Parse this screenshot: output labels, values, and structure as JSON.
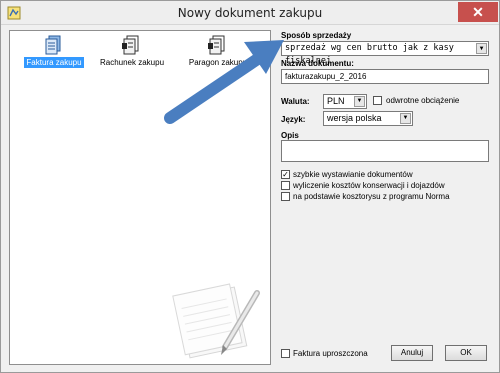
{
  "window": {
    "title": "Nowy dokument zakupu",
    "close_glyph": "✕"
  },
  "documents": [
    {
      "label": "Faktura zakupu",
      "icon": "invoice-icon",
      "selected": true
    },
    {
      "label": "Rachunek zakupu",
      "icon": "bill-icon",
      "selected": false
    },
    {
      "label": "Paragon zakupu",
      "icon": "receipt-icon",
      "selected": false
    }
  ],
  "form": {
    "sale_method_label": "Sposób sprzedaży",
    "sale_method_value": "sprzedaż wg cen brutto jak z kasy fiskalnej",
    "doc_name_label": "Nazwa dokumentu:",
    "doc_name_value": "fakturazakupu_2_2016",
    "currency_label": "Waluta:",
    "currency_value": "PLN",
    "reverse_charge_label": "odwrotne obciążenie",
    "language_label": "Język:",
    "language_value": "wersja polska",
    "description_label": "Opis",
    "description_value": ""
  },
  "options": [
    {
      "label": "szybkie wystawianie dokumentów",
      "checked": true
    },
    {
      "label": "wyliczenie kosztów konserwacji i dojazdów",
      "checked": false
    },
    {
      "label": "na podstawie kosztorysu z programu Norma",
      "checked": false
    }
  ],
  "footer": {
    "simplified_label": "Faktura uproszczona",
    "cancel_label": "Anuluj",
    "ok_label": "OK"
  },
  "colors": {
    "selection": "#3399ff",
    "arrow": "#4a7ec0",
    "close": "#c7504d"
  }
}
